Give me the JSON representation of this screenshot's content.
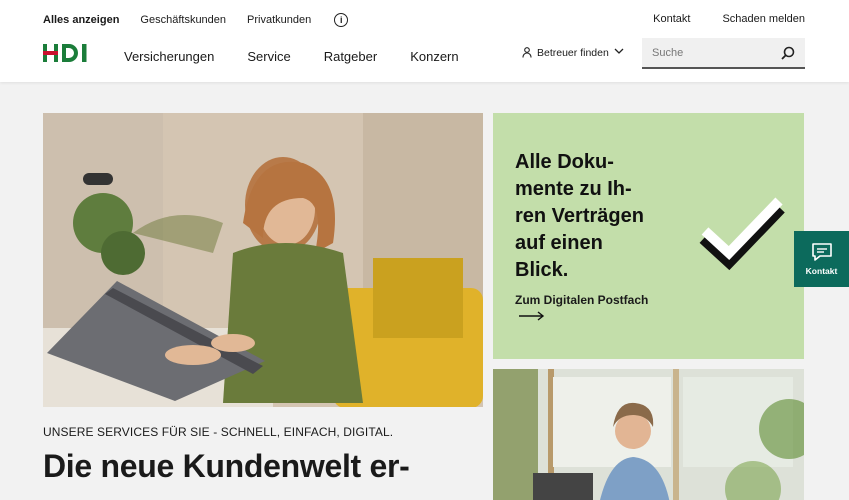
{
  "meta_nav": {
    "items": [
      "Alles anzeigen",
      "Geschäftskunden",
      "Privatkunden"
    ],
    "right_items": [
      "Kontakt",
      "Schaden melden"
    ]
  },
  "brand": {
    "logo_text": "HDI",
    "color": "#1b7d3a"
  },
  "main_nav": [
    "Versicherungen",
    "Service",
    "Ratgeber",
    "Konzern"
  ],
  "betreuer": {
    "label": "Betreuer finden"
  },
  "search": {
    "placeholder": "Suche"
  },
  "green_card": {
    "title_lines": [
      "Alle Doku-",
      "mente zu Ih-",
      "ren Verträgen",
      "auf einen",
      "Blick."
    ],
    "link_label": "Zum Digitalen Postfach",
    "bg_color": "#c3deaa"
  },
  "services_text": "UNSERE SERVICES FÜR SIE - SCHNELL, EINFACH, DIGITAL.",
  "headline": "Die neue Kundenwelt er-",
  "kontakt_tab": {
    "label": "Kontakt",
    "color": "#0c6a5c"
  }
}
